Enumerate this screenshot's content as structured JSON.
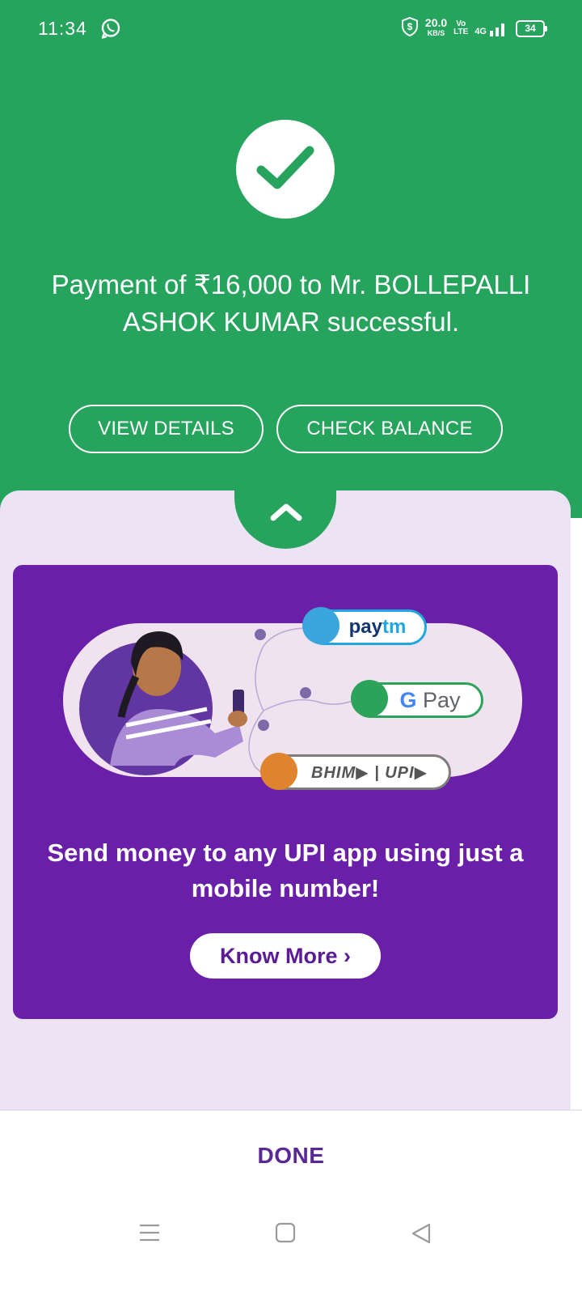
{
  "status_bar": {
    "time": "11:34",
    "net_speed": "20.0",
    "net_speed_unit": "KB/S",
    "volte_top": "Vo",
    "volte_bottom": "LTE",
    "network": "4G",
    "battery": "34",
    "icons": [
      "whatsapp-icon",
      "shield-dollar-icon",
      "signal-icon",
      "battery-icon"
    ]
  },
  "result": {
    "message": "Payment of ₹16,000 to Mr. BOLLEPALLI ASHOK KUMAR successful.",
    "view_details_label": "VIEW DETAILS",
    "check_balance_label": "CHECK BALANCE",
    "status_icon": "check-icon"
  },
  "banner": {
    "apps": {
      "paytm_pay": "pay",
      "paytm_tm": "tm",
      "gpay_g": "G",
      "gpay_pay": "Pay",
      "bhim": "BHIM▶ | UPI▶"
    },
    "text": "Send money to any UPI app using just a mobile number!",
    "cta_label": "Know More ›"
  },
  "footer": {
    "done_label": "DONE"
  },
  "nav": [
    "menu-icon",
    "home-icon",
    "back-icon"
  ],
  "colors": {
    "success_green": "#26a35c",
    "banner_purple": "#6a1fa8",
    "lower_bg": "#ece4f4",
    "done_purple": "#5a2796"
  }
}
